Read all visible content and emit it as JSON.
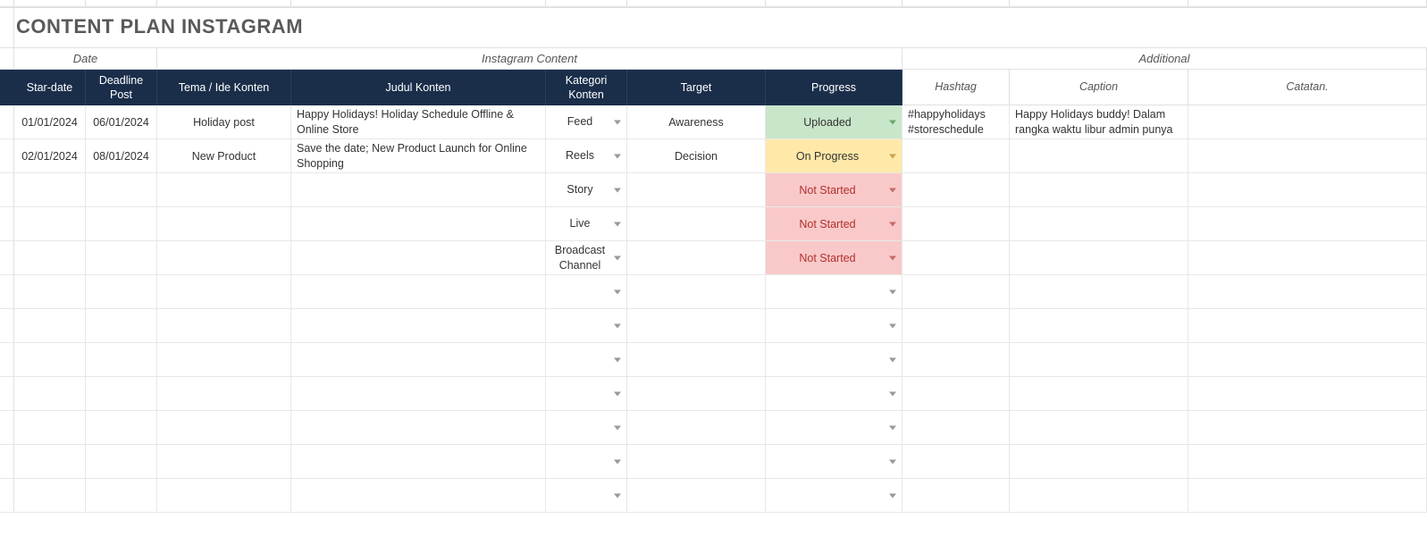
{
  "title": "CONTENT PLAN INSTAGRAM",
  "groups": {
    "date": "Date",
    "instagram": "Instagram Content",
    "additional": "Additional"
  },
  "headers": {
    "start": "Star-date",
    "deadline": "Deadline Post",
    "tema": "Tema / Ide Konten",
    "judul": "Judul Konten",
    "kategori": "Kategori Konten",
    "target": "Target",
    "progress": "Progress",
    "hashtag": "Hashtag",
    "caption": "Caption",
    "catatan": "Catatan."
  },
  "rows": [
    {
      "start": "01/01/2024",
      "deadline": "06/01/2024",
      "tema": "Holiday post",
      "judul": "Happy Holidays! Holiday Schedule Offline & Online Store",
      "kategori": "Feed",
      "target": "Awareness",
      "progress": "Uploaded",
      "progressClass": "uploaded",
      "hashtag": "#happyholidays #storeschedule",
      "caption": "Happy Holidays buddy! Dalam rangka waktu libur admin punya",
      "catatan": ""
    },
    {
      "start": "02/01/2024",
      "deadline": "08/01/2024",
      "tema": "New Product",
      "judul": "Save the date; New Product Launch for Online Shopping",
      "kategori": "Reels",
      "target": "Decision",
      "progress": "On Progress",
      "progressClass": "onprogress",
      "hashtag": "",
      "caption": "",
      "catatan": ""
    },
    {
      "start": "",
      "deadline": "",
      "tema": "",
      "judul": "",
      "kategori": "Story",
      "target": "",
      "progress": "Not Started",
      "progressClass": "notstarted",
      "hashtag": "",
      "caption": "",
      "catatan": ""
    },
    {
      "start": "",
      "deadline": "",
      "tema": "",
      "judul": "",
      "kategori": "Live",
      "target": "",
      "progress": "Not Started",
      "progressClass": "notstarted",
      "hashtag": "",
      "caption": "",
      "catatan": ""
    },
    {
      "start": "",
      "deadline": "",
      "tema": "",
      "judul": "",
      "kategori": "Broadcast Channel",
      "target": "",
      "progress": "Not Started",
      "progressClass": "notstarted",
      "hashtag": "",
      "caption": "",
      "catatan": ""
    },
    {
      "start": "",
      "deadline": "",
      "tema": "",
      "judul": "",
      "kategori": "",
      "target": "",
      "progress": "",
      "progressClass": "",
      "hashtag": "",
      "caption": "",
      "catatan": ""
    },
    {
      "start": "",
      "deadline": "",
      "tema": "",
      "judul": "",
      "kategori": "",
      "target": "",
      "progress": "",
      "progressClass": "",
      "hashtag": "",
      "caption": "",
      "catatan": ""
    },
    {
      "start": "",
      "deadline": "",
      "tema": "",
      "judul": "",
      "kategori": "",
      "target": "",
      "progress": "",
      "progressClass": "",
      "hashtag": "",
      "caption": "",
      "catatan": ""
    },
    {
      "start": "",
      "deadline": "",
      "tema": "",
      "judul": "",
      "kategori": "",
      "target": "",
      "progress": "",
      "progressClass": "",
      "hashtag": "",
      "caption": "",
      "catatan": ""
    },
    {
      "start": "",
      "deadline": "",
      "tema": "",
      "judul": "",
      "kategori": "",
      "target": "",
      "progress": "",
      "progressClass": "",
      "hashtag": "",
      "caption": "",
      "catatan": ""
    },
    {
      "start": "",
      "deadline": "",
      "tema": "",
      "judul": "",
      "kategori": "",
      "target": "",
      "progress": "",
      "progressClass": "",
      "hashtag": "",
      "caption": "",
      "catatan": ""
    },
    {
      "start": "",
      "deadline": "",
      "tema": "",
      "judul": "",
      "kategori": "",
      "target": "",
      "progress": "",
      "progressClass": "",
      "hashtag": "",
      "caption": "",
      "catatan": ""
    }
  ]
}
